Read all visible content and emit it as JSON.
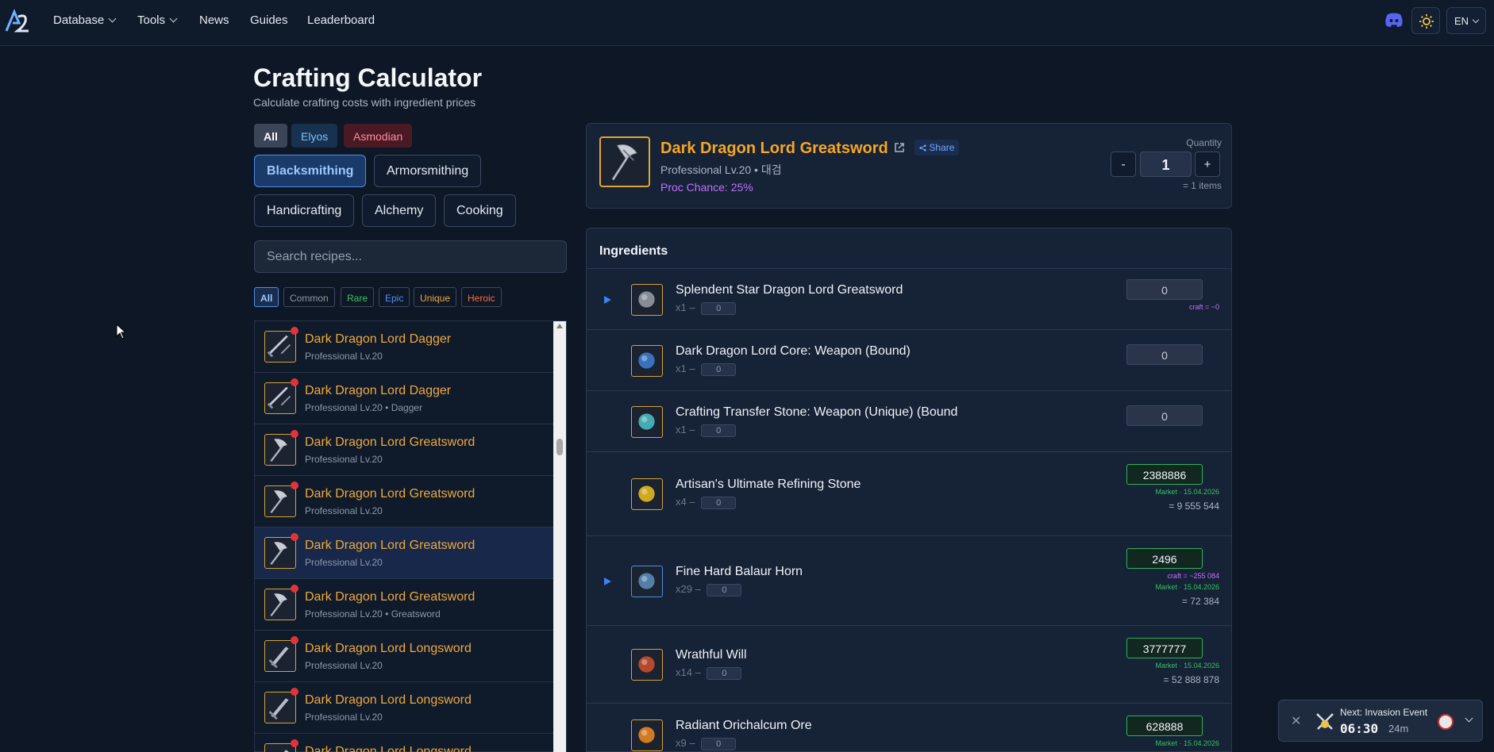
{
  "nav": {
    "items": [
      {
        "label": "Database",
        "dropdown": true
      },
      {
        "label": "Tools",
        "dropdown": true
      },
      {
        "label": "News",
        "dropdown": false
      },
      {
        "label": "Guides",
        "dropdown": false
      },
      {
        "label": "Leaderboard",
        "dropdown": false
      }
    ],
    "language": "EN",
    "icons": [
      "discord-icon",
      "sun-icon"
    ]
  },
  "page": {
    "title": "Crafting Calculator",
    "subtitle": "Calculate crafting costs with ingredient prices"
  },
  "factions": [
    {
      "label": "All",
      "active": true
    },
    {
      "label": "Elyos",
      "active": false
    },
    {
      "label": "Asmodian",
      "active": false
    }
  ],
  "professions": [
    {
      "label": "Blacksmithing",
      "active": true
    },
    {
      "label": "Armorsmithing",
      "active": false
    },
    {
      "label": "Handicrafting",
      "active": false
    },
    {
      "label": "Alchemy",
      "active": false
    },
    {
      "label": "Cooking",
      "active": false
    }
  ],
  "search": {
    "placeholder": "Search recipes..."
  },
  "rarities": [
    {
      "label": "All",
      "color": "#5a9cff"
    },
    {
      "label": "Common",
      "color": "#8d98a8"
    },
    {
      "label": "Rare",
      "color": "#35c35f"
    },
    {
      "label": "Epic",
      "color": "#4b8fff"
    },
    {
      "label": "Unique",
      "color": "#f0a93a"
    },
    {
      "label": "Heroic",
      "color": "#ff6a3d"
    }
  ],
  "recipes": [
    {
      "name": "Dark Dragon Lord Dagger",
      "sub": "Professional Lv.20",
      "icon": "dagger-icon",
      "selected": false
    },
    {
      "name": "Dark Dragon Lord Dagger",
      "sub": "Professional Lv.20 • Dagger",
      "icon": "dagger-icon",
      "selected": false
    },
    {
      "name": "Dark Dragon Lord Greatsword",
      "sub": "Professional Lv.20",
      "icon": "axe-icon",
      "selected": false
    },
    {
      "name": "Dark Dragon Lord Greatsword",
      "sub": "Professional Lv.20",
      "icon": "axe-icon",
      "selected": false
    },
    {
      "name": "Dark Dragon Lord Greatsword",
      "sub": "Professional Lv.20",
      "icon": "axe-icon",
      "selected": true
    },
    {
      "name": "Dark Dragon Lord Greatsword",
      "sub": "Professional Lv.20 • Greatsword",
      "icon": "axe-icon",
      "selected": false
    },
    {
      "name": "Dark Dragon Lord Longsword",
      "sub": "Professional Lv.20",
      "icon": "sword-icon",
      "selected": false
    },
    {
      "name": "Dark Dragon Lord Longsword",
      "sub": "Professional Lv.20",
      "icon": "sword-icon",
      "selected": false
    },
    {
      "name": "Dark Dragon Lord Longsword",
      "sub": "",
      "icon": "sword-icon",
      "selected": false
    }
  ],
  "item": {
    "title": "Dark Dragon Lord Greatsword",
    "share_label": "Share",
    "subtitle": "Professional Lv.20 • 대검",
    "proc": "Proc Chance: 25%",
    "quantity_label": "Quantity",
    "quantity": "1",
    "minus": "-",
    "plus": "+",
    "items_total": "= 1 items"
  },
  "ingredients_title": "Ingredients",
  "ingredients": [
    {
      "name": "Splendent Star Dragon Lord Greatsword",
      "mult": "x1",
      "mini": "0",
      "price": "0",
      "market": false,
      "expandable": true,
      "craft": "craft = ~0",
      "market_note": "",
      "total": "",
      "icon_border": "gold"
    },
    {
      "name": "Dark Dragon Lord Core: Weapon (Bound)",
      "mult": "x1",
      "mini": "0",
      "price": "0",
      "market": false,
      "expandable": false,
      "craft": "",
      "market_note": "",
      "total": "",
      "icon_border": "gold"
    },
    {
      "name": "Crafting Transfer Stone: Weapon (Unique) (Bound",
      "mult": "x1",
      "mini": "0",
      "price": "0",
      "market": false,
      "expandable": false,
      "craft": "",
      "market_note": "",
      "total": "",
      "icon_border": "gold"
    },
    {
      "name": "Artisan's Ultimate Refining Stone",
      "mult": "x4",
      "mini": "0",
      "price": "2388886",
      "market": true,
      "expandable": false,
      "craft": "",
      "market_note": "Market · 15.04.2026",
      "total": "= 9 555 544",
      "icon_border": "gold"
    },
    {
      "name": "Fine Hard Balaur Horn",
      "mult": "x29",
      "mini": "0",
      "price": "2496",
      "market": true,
      "expandable": true,
      "craft": "craft = ~255 084",
      "market_note": "Market · 15.04.2026",
      "total": "= 72 384",
      "icon_border": "blue"
    },
    {
      "name": "Wrathful Will",
      "mult": "x14",
      "mini": "0",
      "price": "3777777",
      "market": true,
      "expandable": false,
      "craft": "",
      "market_note": "Market · 15.04.2026",
      "total": "= 52 888 878",
      "icon_border": "gold"
    },
    {
      "name": "Radiant Orichalcum Ore",
      "mult": "x9",
      "mini": "0",
      "price": "628888",
      "market": true,
      "expandable": false,
      "craft": "",
      "market_note": "Market · 15.04.2026",
      "total": "",
      "icon_border": "gold"
    }
  ],
  "toast": {
    "title": "Next: Invasion Event",
    "time": "06:30",
    "remaining": "24m",
    "close": "✕"
  }
}
